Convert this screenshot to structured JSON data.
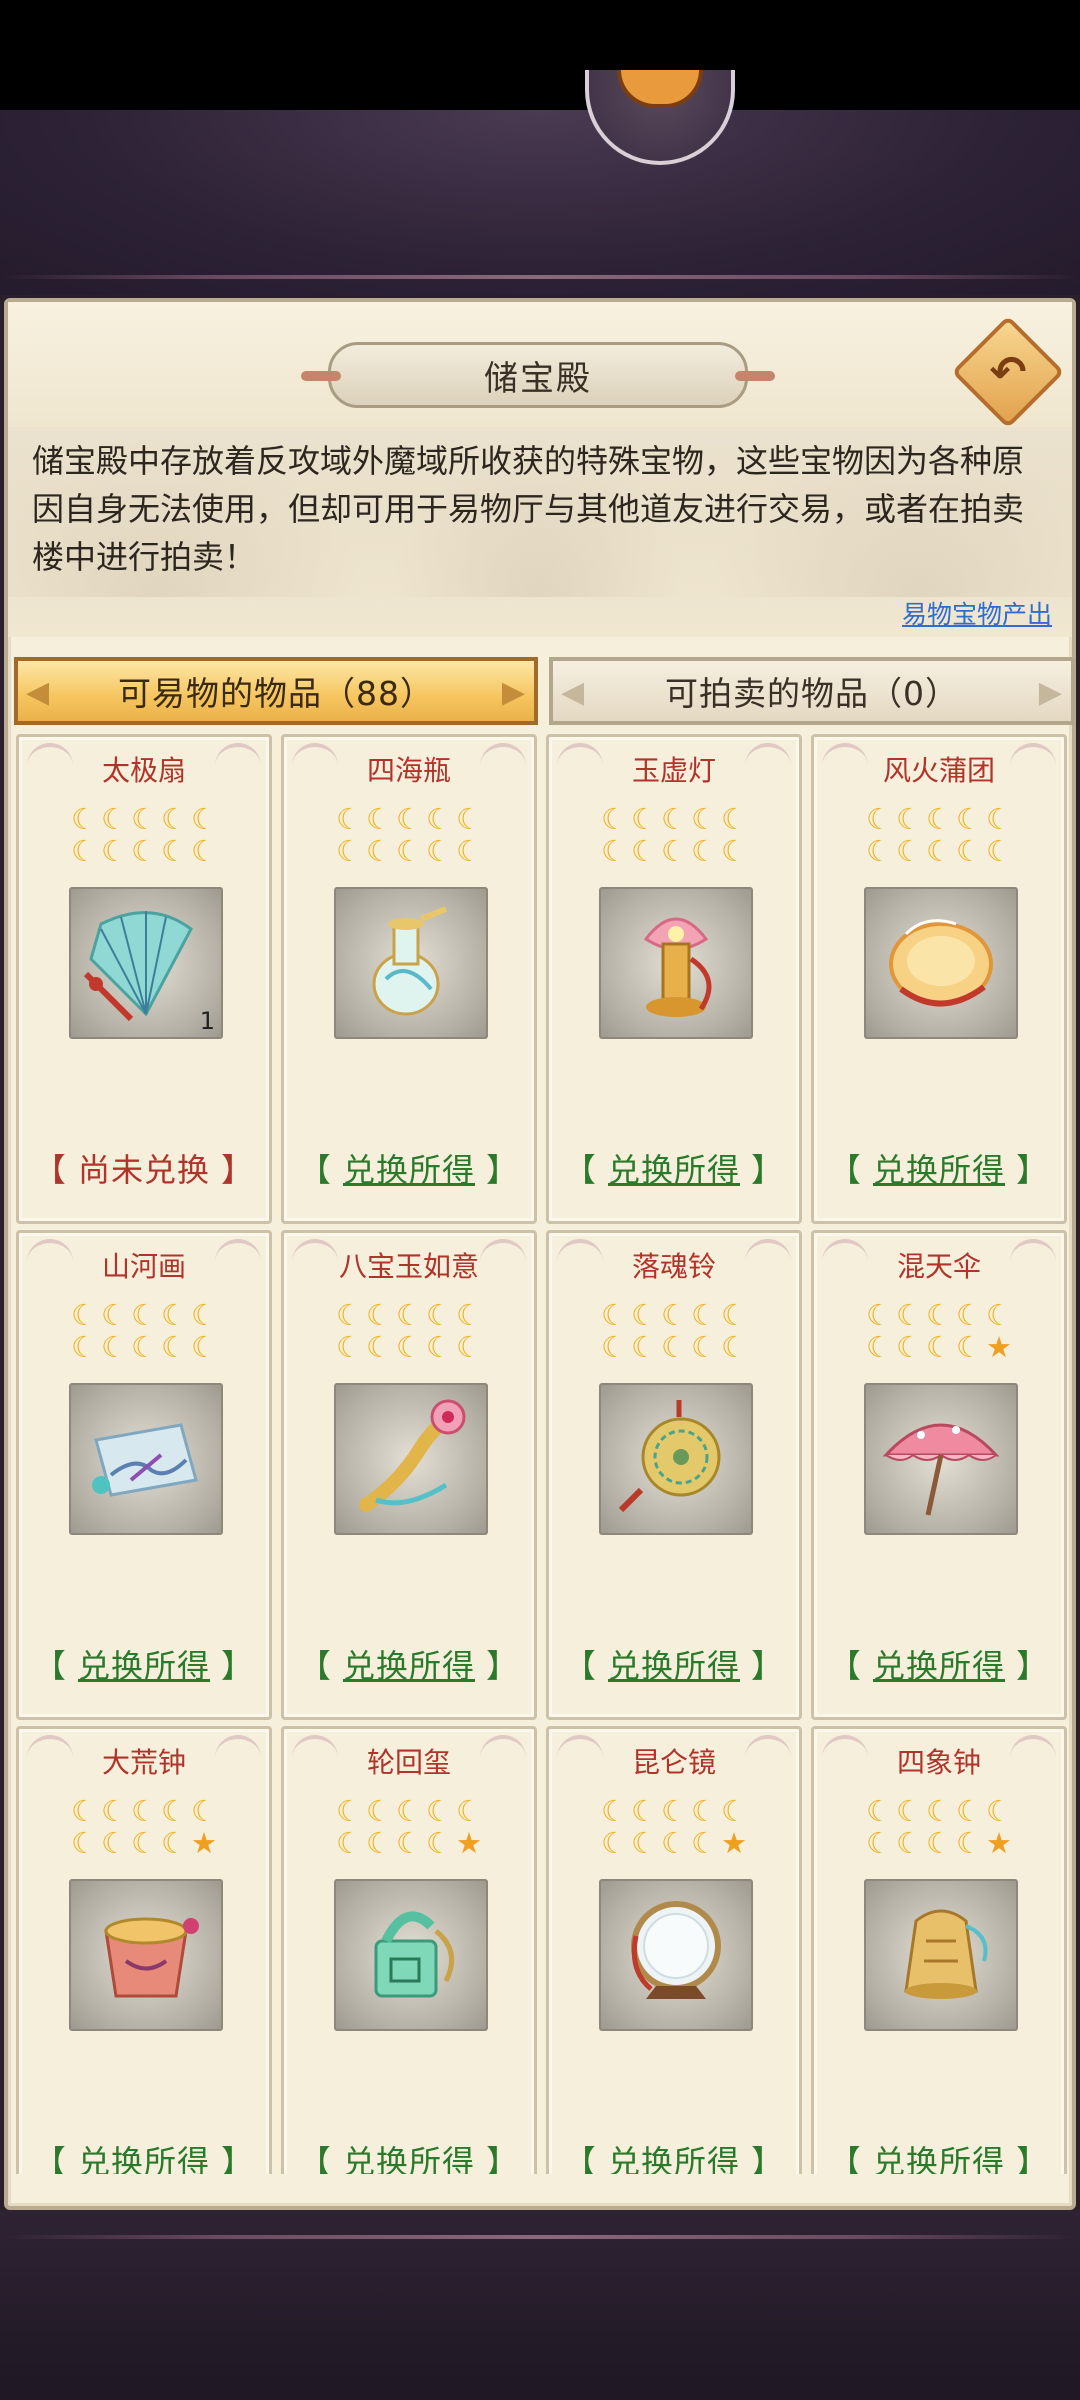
{
  "header": {
    "title": "储宝殿",
    "description": "储宝殿中存放着反攻域外魔域所收获的特殊宝物，这些宝物因为各种原因自身无法使用，但却可用于易物厅与其他道友进行交易，或者在拍卖楼中进行拍卖！",
    "source_link": "易物宝物产出"
  },
  "tabs": [
    {
      "label": "可易物的物品（88）",
      "active": true
    },
    {
      "label": "可拍卖的物品（0）",
      "active": false
    }
  ],
  "status_labels": {
    "redeemed": "兑换所得",
    "not_redeemed": "尚未兑换"
  },
  "items": [
    {
      "name": "太极扇",
      "moons": 10,
      "stars": 0,
      "quantity": "1",
      "status": "尚未兑换",
      "redeemed": false,
      "icon": "fan-icon"
    },
    {
      "name": "四海瓶",
      "moons": 10,
      "stars": 0,
      "quantity": "",
      "status": "兑换所得",
      "redeemed": true,
      "icon": "vase-icon"
    },
    {
      "name": "玉虚灯",
      "moons": 10,
      "stars": 0,
      "quantity": "",
      "status": "兑换所得",
      "redeemed": true,
      "icon": "lotus-lamp-icon"
    },
    {
      "name": "风火蒲团",
      "moons": 10,
      "stars": 0,
      "quantity": "",
      "status": "兑换所得",
      "redeemed": true,
      "icon": "cushion-icon"
    },
    {
      "name": "山河画",
      "moons": 10,
      "stars": 0,
      "quantity": "",
      "status": "兑换所得",
      "redeemed": true,
      "icon": "scroll-icon"
    },
    {
      "name": "八宝玉如意",
      "moons": 10,
      "stars": 0,
      "quantity": "",
      "status": "兑换所得",
      "redeemed": true,
      "icon": "ruyi-icon"
    },
    {
      "name": "落魂铃",
      "moons": 10,
      "stars": 0,
      "quantity": "",
      "status": "兑换所得",
      "redeemed": true,
      "icon": "bell-icon"
    },
    {
      "name": "混天伞",
      "moons": 9,
      "stars": 1,
      "quantity": "",
      "status": "兑换所得",
      "redeemed": true,
      "icon": "umbrella-icon"
    },
    {
      "name": "大荒钟",
      "moons": 9,
      "stars": 1,
      "quantity": "",
      "status": "兑换所得",
      "redeemed": true,
      "icon": "drum-icon"
    },
    {
      "name": "轮回玺",
      "moons": 9,
      "stars": 1,
      "quantity": "",
      "status": "兑换所得",
      "redeemed": true,
      "icon": "seal-icon"
    },
    {
      "name": "昆仑镜",
      "moons": 9,
      "stars": 1,
      "quantity": "",
      "status": "兑换所得",
      "redeemed": true,
      "icon": "mirror-icon"
    },
    {
      "name": "四象钟",
      "moons": 9,
      "stars": 1,
      "quantity": "",
      "status": "兑换所得",
      "redeemed": true,
      "icon": "bronze-bell-icon"
    }
  ],
  "colors": {
    "name_red": "#b0342a",
    "redeemed_green": "#2b7a2b",
    "moon_gold": "#f2b31e",
    "tab_active": "#f6c55e",
    "link_blue": "#2f6dd0"
  }
}
